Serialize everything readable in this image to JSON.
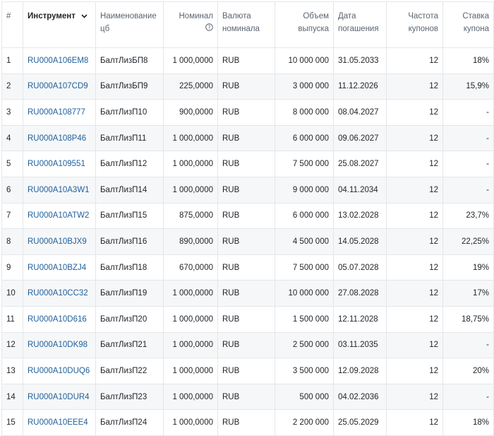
{
  "table": {
    "headers": {
      "num": "#",
      "instrument": "Инструмент",
      "name_l1": "Наименование",
      "name_l2": "цб",
      "nominal": "Номинал",
      "currency_l1": "Валюта",
      "currency_l2": "номинала",
      "volume_l1": "Объем",
      "volume_l2": "выпуска",
      "maturity_l1": "Дата",
      "maturity_l2": "погашения",
      "freq_l1": "Частота",
      "freq_l2": "купонов",
      "rate_l1": "Ставка",
      "rate_l2": "купона"
    },
    "rows": [
      {
        "num": "1",
        "isin": "RU000A106EM8",
        "name": "БалтЛизБП8",
        "nominal": "1 000,0000",
        "currency": "RUB",
        "volume": "10 000 000",
        "maturity": "31.05.2033",
        "freq": "12",
        "rate": "18%"
      },
      {
        "num": "2",
        "isin": "RU000A107CD9",
        "name": "БалтЛизБП9",
        "nominal": "225,0000",
        "currency": "RUB",
        "volume": "3 000 000",
        "maturity": "11.12.2026",
        "freq": "12",
        "rate": "15,9%"
      },
      {
        "num": "3",
        "isin": "RU000A108777",
        "name": "БалтЛизП10",
        "nominal": "900,0000",
        "currency": "RUB",
        "volume": "8 000 000",
        "maturity": "08.04.2027",
        "freq": "12",
        "rate": "-"
      },
      {
        "num": "4",
        "isin": "RU000A108P46",
        "name": "БалтЛизП11",
        "nominal": "1 000,0000",
        "currency": "RUB",
        "volume": "6 000 000",
        "maturity": "09.06.2027",
        "freq": "12",
        "rate": "-"
      },
      {
        "num": "5",
        "isin": "RU000A109551",
        "name": "БалтЛизП12",
        "nominal": "1 000,0000",
        "currency": "RUB",
        "volume": "7 500 000",
        "maturity": "25.08.2027",
        "freq": "12",
        "rate": "-"
      },
      {
        "num": "6",
        "isin": "RU000A10A3W1",
        "name": "БалтЛизП14",
        "nominal": "1 000,0000",
        "currency": "RUB",
        "volume": "9 000 000",
        "maturity": "04.11.2034",
        "freq": "12",
        "rate": "-"
      },
      {
        "num": "7",
        "isin": "RU000A10ATW2",
        "name": "БалтЛизП15",
        "nominal": "875,0000",
        "currency": "RUB",
        "volume": "6 000 000",
        "maturity": "13.02.2028",
        "freq": "12",
        "rate": "23,7%"
      },
      {
        "num": "8",
        "isin": "RU000A10BJX9",
        "name": "БалтЛизП16",
        "nominal": "890,0000",
        "currency": "RUB",
        "volume": "4 500 000",
        "maturity": "14.05.2028",
        "freq": "12",
        "rate": "22,25%"
      },
      {
        "num": "9",
        "isin": "RU000A10BZJ4",
        "name": "БалтЛизП18",
        "nominal": "670,0000",
        "currency": "RUB",
        "volume": "7 500 000",
        "maturity": "05.07.2028",
        "freq": "12",
        "rate": "19%"
      },
      {
        "num": "10",
        "isin": "RU000A10CC32",
        "name": "БалтЛизП19",
        "nominal": "1 000,0000",
        "currency": "RUB",
        "volume": "10 000 000",
        "maturity": "27.08.2028",
        "freq": "12",
        "rate": "17%"
      },
      {
        "num": "11",
        "isin": "RU000A10D616",
        "name": "БалтЛизП20",
        "nominal": "1 000,0000",
        "currency": "RUB",
        "volume": "1 500 000",
        "maturity": "12.11.2028",
        "freq": "12",
        "rate": "18,75%"
      },
      {
        "num": "12",
        "isin": "RU000A10DK98",
        "name": "БалтЛизП21",
        "nominal": "1 000,0000",
        "currency": "RUB",
        "volume": "2 500 000",
        "maturity": "03.11.2035",
        "freq": "12",
        "rate": "-"
      },
      {
        "num": "13",
        "isin": "RU000A10DUQ6",
        "name": "БалтЛизП22",
        "nominal": "1 000,0000",
        "currency": "RUB",
        "volume": "3 500 000",
        "maturity": "12.09.2028",
        "freq": "12",
        "rate": "20%"
      },
      {
        "num": "14",
        "isin": "RU000A10DUR4",
        "name": "БалтЛизП23",
        "nominal": "1 000,0000",
        "currency": "RUB",
        "volume": "500 000",
        "maturity": "04.02.2036",
        "freq": "12",
        "rate": "-"
      },
      {
        "num": "15",
        "isin": "RU000A10EEE4",
        "name": "БалтЛизП24",
        "nominal": "1 000,0000",
        "currency": "RUB",
        "volume": "2 200 000",
        "maturity": "25.05.2029",
        "freq": "12",
        "rate": "18%"
      }
    ]
  },
  "colors": {
    "link": "#1f5f9c",
    "border": "#e3e6ea",
    "stripe": "#f6f7f8",
    "header_text": "#5b6470"
  },
  "icons": {
    "sort": "chevron-down-icon",
    "nominal_info": "question-circle-icon"
  }
}
